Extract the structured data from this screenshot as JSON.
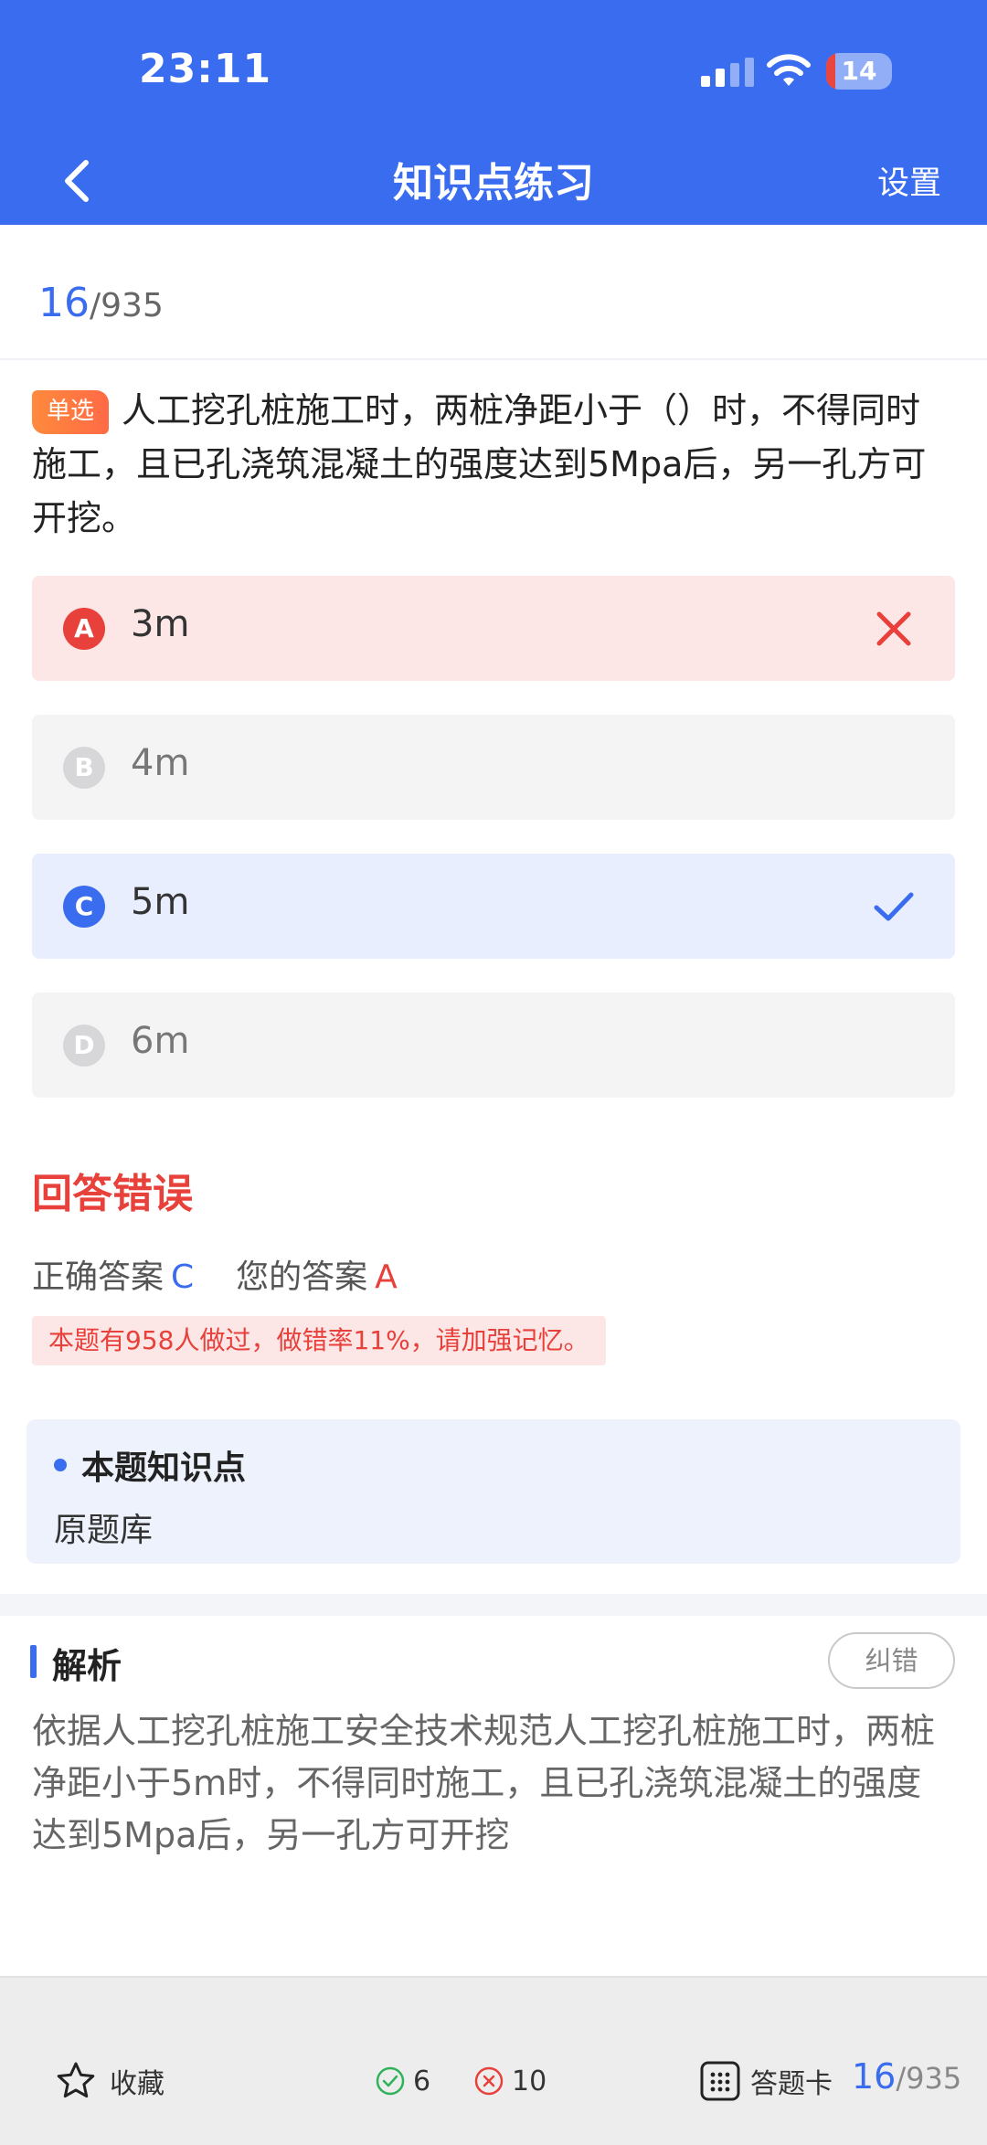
{
  "status_bar": {
    "time": "23:11",
    "battery": "14",
    "battery_level": 0.14
  },
  "nav": {
    "title": "知识点练习",
    "settings_label": "设置"
  },
  "progress": {
    "current": "16",
    "total": "/935"
  },
  "question": {
    "type_tag": "单选",
    "text": "人工挖孔桩施工时，两桩净距小于（）时，不得同时施工，且已孔浇筑混凝土的强度达到5Mpa后，另一孔方可开挖。"
  },
  "options": [
    {
      "letter": "A",
      "text": "3m",
      "state": "wrong"
    },
    {
      "letter": "B",
      "text": "4m",
      "state": "plain"
    },
    {
      "letter": "C",
      "text": "5m",
      "state": "right"
    },
    {
      "letter": "D",
      "text": "6m",
      "state": "plain"
    }
  ],
  "result": {
    "title": "回答错误",
    "correct_label": "正确答案",
    "correct_value": "C",
    "yours_label": "您的答案",
    "yours_value": "A",
    "stat_tip": "本题有958人做过，做错率11%，请加强记忆。"
  },
  "knowledge": {
    "title": "本题知识点",
    "text": "原题库"
  },
  "analysis": {
    "title": "解析",
    "report_label": "纠错",
    "text": "依据人工挖孔桩施工安全技术规范人工挖孔桩施工时，两桩净距小于5m时，不得同时施工，且已孔浇筑混凝土的强度达到5Mpa后，另一孔方可开挖"
  },
  "bottom": {
    "favorite_label": "收藏",
    "correct_count": "6",
    "wrong_count": "10",
    "answer_card_label": "答题卡",
    "current": "16",
    "total": "/935"
  },
  "colors": {
    "accent": "#3a6cf0",
    "error": "#e8403a",
    "tag": "#ff7a40"
  }
}
